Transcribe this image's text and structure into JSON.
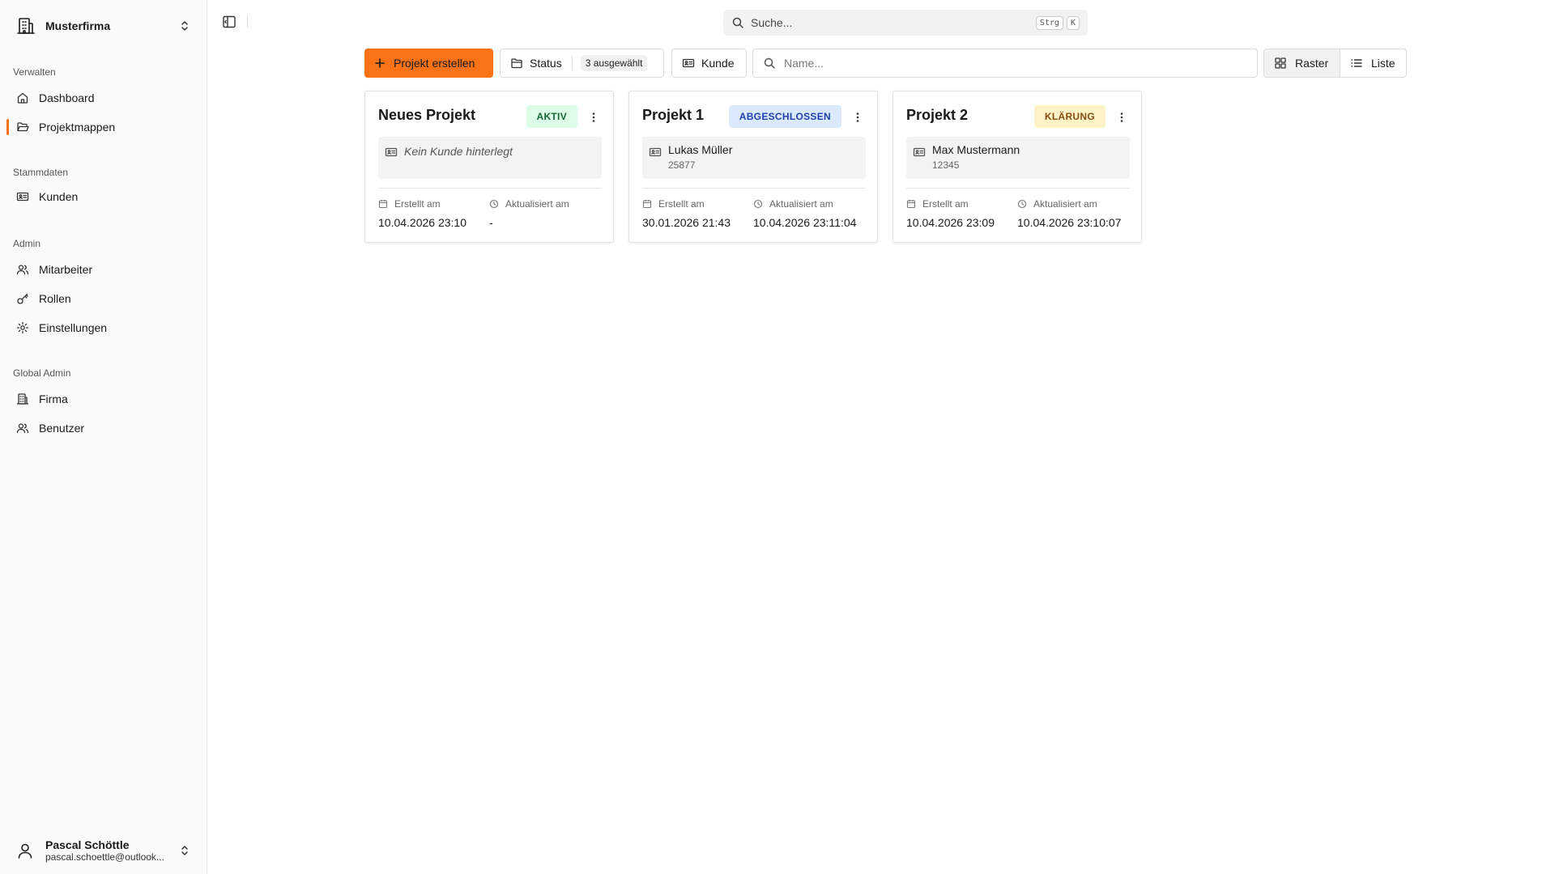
{
  "sidebar": {
    "org_name": "Musterfirma",
    "groups": [
      {
        "label": "Verwalten",
        "items": [
          {
            "label": "Dashboard"
          },
          {
            "label": "Projektmappen",
            "active": true
          }
        ]
      },
      {
        "label": "Stammdaten",
        "items": [
          {
            "label": "Kunden"
          }
        ]
      },
      {
        "label": "Admin",
        "items": [
          {
            "label": "Mitarbeiter"
          },
          {
            "label": "Rollen"
          },
          {
            "label": "Einstellungen"
          }
        ]
      },
      {
        "label": "Global Admin",
        "items": [
          {
            "label": "Firma"
          },
          {
            "label": "Benutzer"
          }
        ]
      }
    ],
    "user": {
      "name": "Pascal Schöttle",
      "email": "pascal.schoettle@outlook..."
    }
  },
  "topbar": {
    "search_placeholder": "Suche...",
    "shortcut_keys": [
      "Strg",
      "K"
    ]
  },
  "toolbar": {
    "create_label": "Projekt erstellen",
    "status_label": "Status",
    "status_selected": "3 ausgewählt",
    "customer_label": "Kunde",
    "name_placeholder": "Name...",
    "view_grid": "Raster",
    "view_list": "Liste",
    "active_view": "Raster"
  },
  "colors": {
    "accent": "#f97316",
    "badge_active": "#dcfce7",
    "badge_done": "#dbeafe",
    "badge_clarify": "#fef3c7"
  },
  "projects": [
    {
      "title": "Neues Projekt",
      "status": "AKTIV",
      "customer_empty": "Kein Kunde hinterlegt",
      "created_label": "Erstellt am",
      "created": "10.04.2026 23:10",
      "updated_label": "Aktualisiert am",
      "updated": "-"
    },
    {
      "title": "Projekt 1",
      "status": "ABGESCHLOSSEN",
      "customer_name": "Lukas Müller",
      "customer_number": "25877",
      "created_label": "Erstellt am",
      "created": "30.01.2026 21:43",
      "updated_label": "Aktualisiert am",
      "updated": "10.04.2026 23:11:04"
    },
    {
      "title": "Projekt 2",
      "status": "KLÄRUNG",
      "customer_name": "Max Mustermann",
      "customer_number": "12345",
      "created_label": "Erstellt am",
      "created": "10.04.2026 23:09",
      "updated_label": "Aktualisiert am",
      "updated": "10.04.2026 23:10:07"
    }
  ],
  "icons": {
    "org": "building-icon",
    "dashboard": "house-icon",
    "projektmappen": "folder-icon",
    "kunden": "id-card-icon",
    "mitarbeiter": "users-icon",
    "rollen": "key-icon",
    "einstellungen": "gear-icon",
    "firma": "building-icon",
    "benutzer": "users-icon"
  }
}
